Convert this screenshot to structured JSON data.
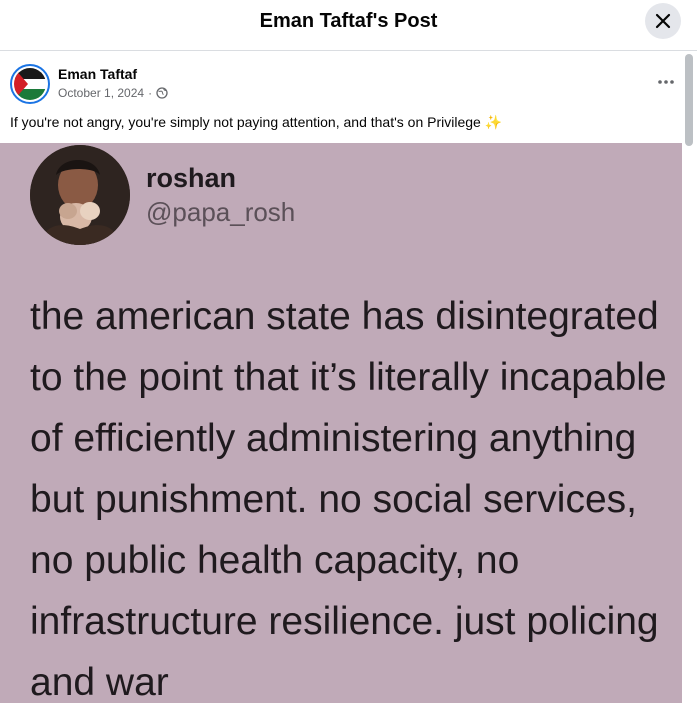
{
  "dialog": {
    "title": "Eman Taftaf's Post",
    "close_icon": "close-icon"
  },
  "post": {
    "author": "Eman Taftaf",
    "date": "October 1, 2024",
    "separator": "·",
    "privacy_icon": "globe-icon",
    "more_icon": "more-horizontal-icon",
    "caption": "If you're not angry, you're simply not paying attention, and that's on Privilege",
    "caption_emoji": "✨"
  },
  "image": {
    "name": "roshan",
    "handle": "@papa_rosh",
    "lines": [
      "the american state has disintegrated",
      "to the point that it’s literally incapable",
      "of efficiently administering anything",
      "but punishment. no social services,",
      "no public health capacity, no",
      "infrastructure resilience. just policing",
      "and war"
    ]
  },
  "colors": {
    "accent": "#1b74e4",
    "image_background": "#c0aab8",
    "secondary_text": "#65676b"
  }
}
